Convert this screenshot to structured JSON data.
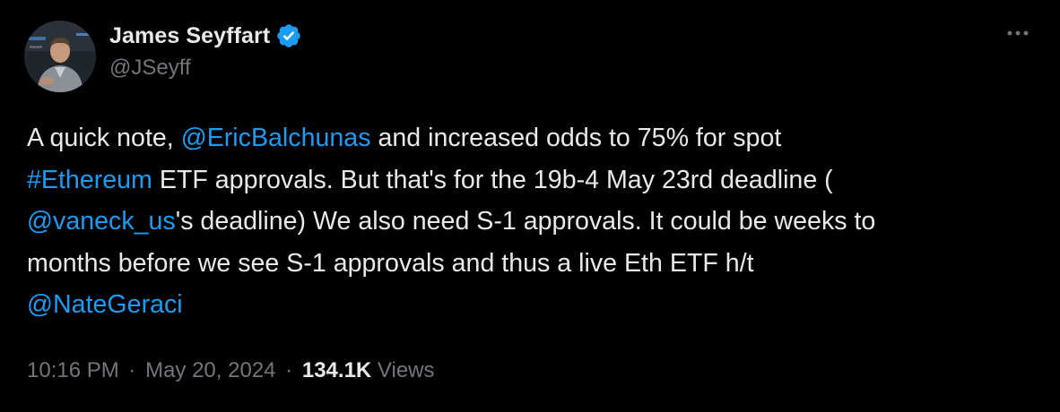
{
  "author": {
    "name": "James Seyffart",
    "handle": "@JSeyff",
    "verified": true,
    "verified_color": "#1d9bf0",
    "avatar": "profile-photo"
  },
  "more_icon": "ellipsis-icon",
  "tweet": {
    "line1": {
      "pre": "A quick note, ",
      "mention1": "@EricBalchunas",
      "post": " and increased odds to 75% for spot"
    },
    "line2": {
      "hashtag": "#Ethereum",
      "post": " ETF approvals. But that's for the 19b-4 May 23rd deadline ("
    },
    "line3": {
      "mention": "@vaneck_us",
      "post": "'s deadline) We also need S-1 approvals. It could be weeks to"
    },
    "line4": {
      "text": "months before we see S-1 approvals and thus a live Eth ETF h/t"
    },
    "line5": {
      "mention": "@NateGeraci"
    }
  },
  "meta": {
    "time": "10:16 PM",
    "separator": "·",
    "date": "May 20, 2024",
    "views_count": "134.1K",
    "views_label": "Views"
  },
  "colors": {
    "background": "#000000",
    "text": "#e7e9ea",
    "secondary": "#71767b",
    "link": "#1d9bf0"
  }
}
